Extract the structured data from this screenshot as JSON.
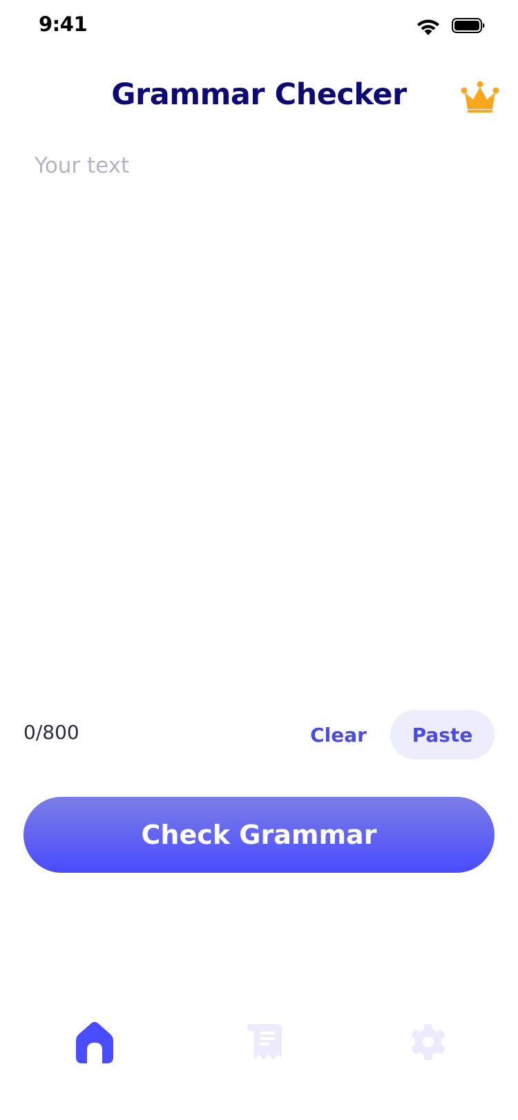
{
  "status_bar": {
    "time": "9:41",
    "wifi_icon": "wifi-icon",
    "battery_icon": "battery-icon"
  },
  "header": {
    "title": "Grammar Checker",
    "premium_icon": "crown-icon"
  },
  "editor": {
    "placeholder": "Your text",
    "value": ""
  },
  "actions": {
    "char_count": "0/800",
    "clear_label": "Clear",
    "paste_label": "Paste"
  },
  "primary_action": {
    "label": "Check Grammar"
  },
  "tab_bar": {
    "tabs": [
      {
        "icon": "home-icon",
        "active": true
      },
      {
        "icon": "history-icon",
        "active": false
      },
      {
        "icon": "gear-icon",
        "active": false
      }
    ]
  },
  "colors": {
    "title": "#0d0b73",
    "accent": "#4a4be3",
    "crown": "#f8a61e",
    "tab_active": "#4a4cff",
    "tab_inactive": "#eceafc",
    "paste_bg": "#eeedfb",
    "placeholder": "#b4b3c2"
  }
}
